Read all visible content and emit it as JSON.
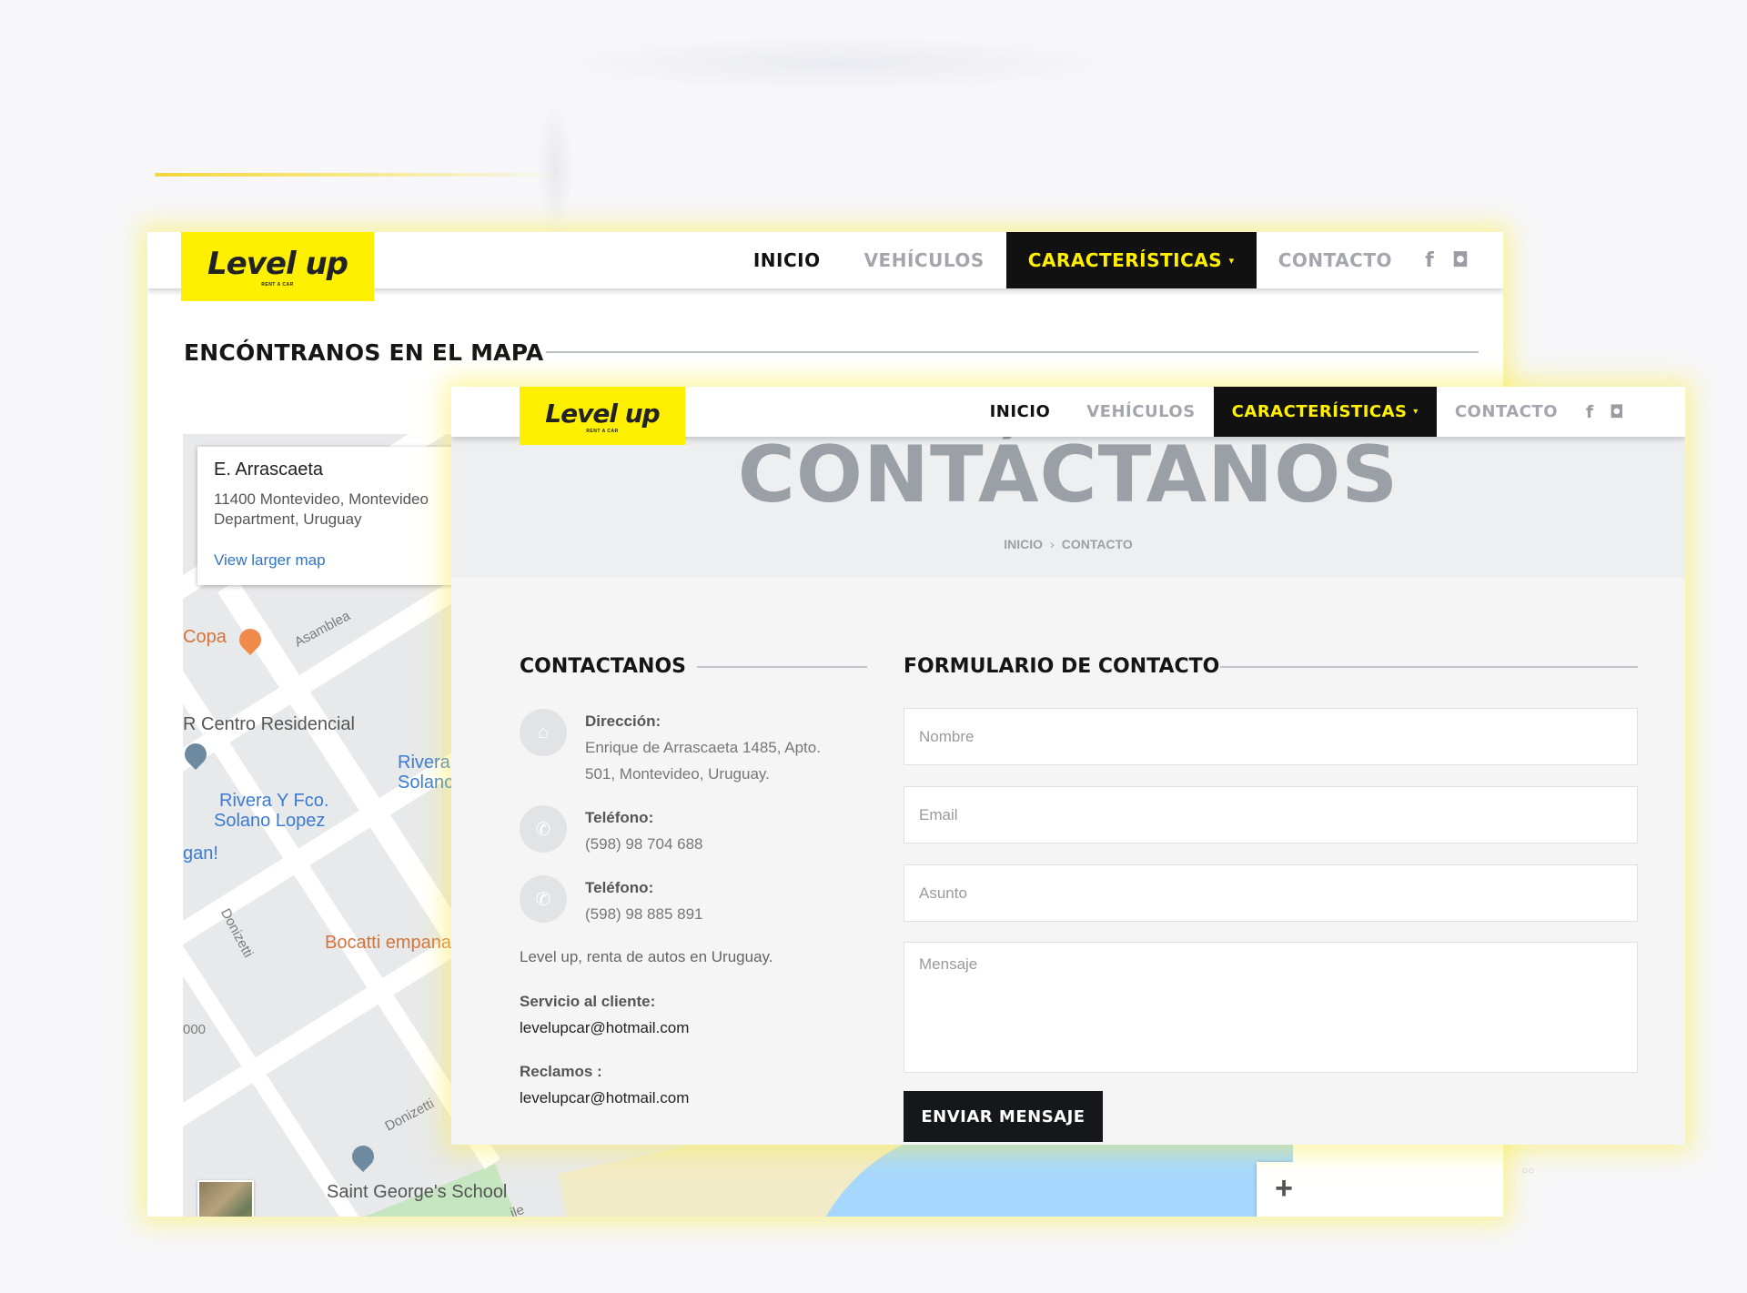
{
  "back_window": {
    "logo": {
      "main": "Level up",
      "sub": "RENT A CAR"
    },
    "nav": {
      "items": [
        "INICIO",
        "VEHÍCULOS",
        "CARACTERÍSTICAS",
        "CONTACTO"
      ],
      "active_index": 0,
      "highlight_index": 2,
      "dropdown_glyph": "▾"
    },
    "social": {
      "facebook": "f",
      "instagram": "◘"
    },
    "section_title": "ENCÓNTRANOS EN EL MAPA",
    "map": {
      "info_title": "E. Arrascaeta",
      "info_address_line1": "11400 Montevideo, Montevideo",
      "info_address_line2": "Department, Uruguay",
      "view_larger": "View larger map",
      "labels": {
        "copa": "Copa",
        "asamblea": "Asamblea",
        "centro": "R Centro Residencial",
        "rivera_short": "Rivera",
        "solano_short": "Solanc",
        "rivera_stop1": "Rivera Y Fco.",
        "rivera_stop2": "Solano Lopez",
        "gan": "gan!",
        "donizetti1": "Donizetti",
        "bocatti": "Bocatti empana",
        "num": "000",
        "donizetti2": "Donizetti",
        "school": "Saint George's School",
        "ile": "ile"
      },
      "zoom_in": "+",
      "zoom_out": "—"
    }
  },
  "front_window": {
    "logo": {
      "main": "Level up",
      "sub": "RENT A CAR"
    },
    "nav": {
      "items": [
        "INICIO",
        "VEHÍCULOS",
        "CARACTERÍSTICAS",
        "CONTACTO"
      ],
      "active_index": 0,
      "highlight_index": 2,
      "dropdown_glyph": "▾"
    },
    "social": {
      "facebook": "f",
      "instagram": "◘"
    },
    "banner_title": "CONTÁCTANOS",
    "breadcrumb": {
      "home": "INICIO",
      "separator": "›",
      "current": "CONTACTO"
    },
    "contact": {
      "title": "CONTACTANOS",
      "address_label": "Dirección:",
      "address_line1": "Enrique de Arrascaeta 1485, Apto.",
      "address_line2": "501, Montevideo, Uruguay.",
      "phone1_label": "Teléfono:",
      "phone1": "(598) 98 704 688",
      "phone2_label": "Teléfono:",
      "phone2": "(598) 98 885 891",
      "tagline": "Level up, renta de autos en Uruguay.",
      "service_label": "Servicio al cliente:",
      "service_email": "levelupcar@hotmail.com",
      "claims_label": "Reclamos :",
      "claims_email": "levelupcar@hotmail.com"
    },
    "form": {
      "title": "FORMULARIO DE CONTACTO",
      "name_placeholder": "Nombre",
      "email_placeholder": "Email",
      "subject_placeholder": "Asunto",
      "message_placeholder": "Mensaje",
      "submit": "ENVIAR MENSAJE"
    }
  },
  "pager_dots": "○○",
  "colors": {
    "brand_yellow": "#ffef00",
    "dark": "#111111",
    "link_blue": "#2f74c7"
  }
}
